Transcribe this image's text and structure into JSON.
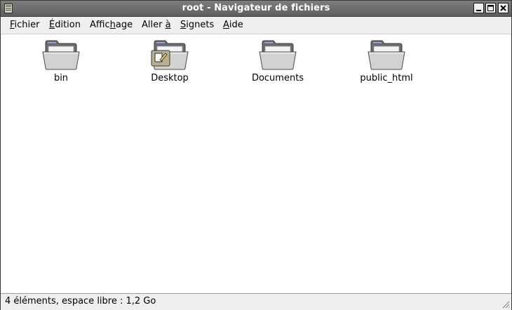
{
  "window": {
    "title": "root - Navigateur de fichiers"
  },
  "menubar": {
    "items": [
      {
        "mnemonic": "F",
        "rest": "ichier"
      },
      {
        "mnemonic": "É",
        "rest": "dition"
      },
      {
        "pre": "Affic",
        "mnemonic": "h",
        "rest": "age"
      },
      {
        "pre": "Aller ",
        "mnemonic": "à",
        "rest": ""
      },
      {
        "mnemonic": "S",
        "rest": "ignets"
      },
      {
        "mnemonic": "A",
        "rest": "ide"
      }
    ]
  },
  "files": [
    {
      "label": "bin",
      "icon": "folder-icon"
    },
    {
      "label": "Desktop",
      "icon": "desktop-folder-icon"
    },
    {
      "label": "Documents",
      "icon": "folder-icon"
    },
    {
      "label": "public_html",
      "icon": "folder-icon"
    }
  ],
  "statusbar": {
    "text": "4 éléments, espace libre : 1,2 Go"
  },
  "colors": {
    "titlebar": "#6e6e6e",
    "window_bg": "#efefef",
    "content_bg": "#ffffff"
  }
}
